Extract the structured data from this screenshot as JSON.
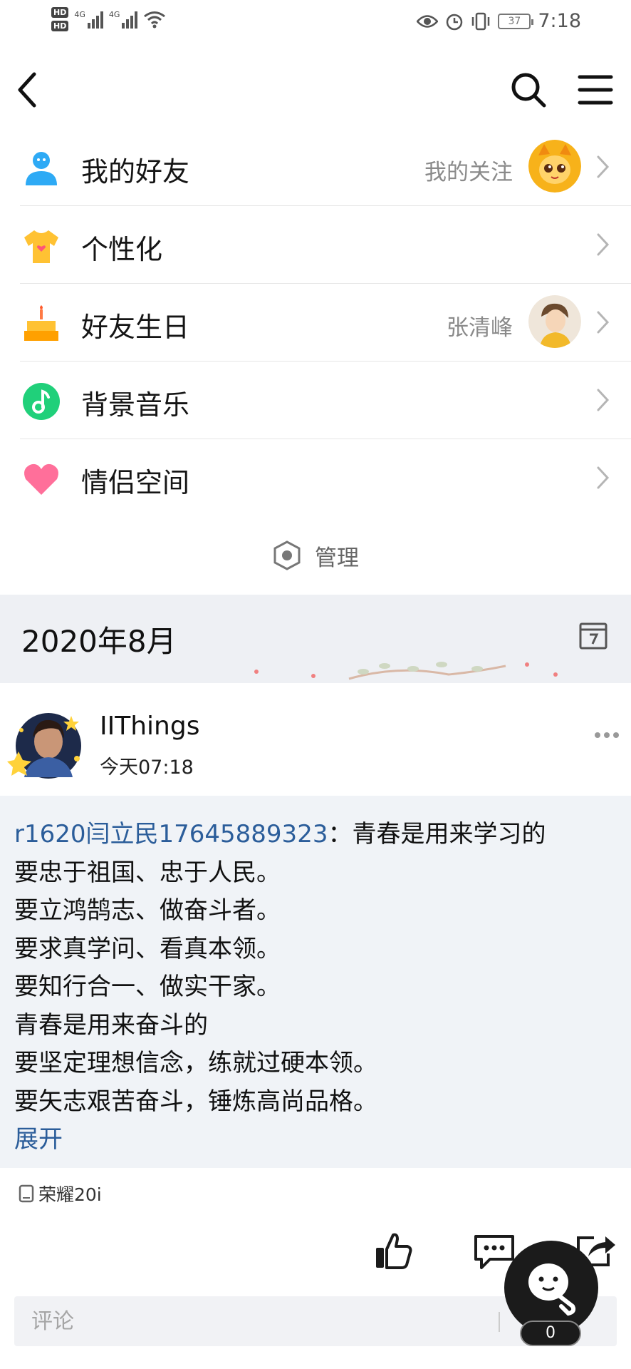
{
  "status_bar": {
    "time": "7:18",
    "battery": "37",
    "network_label_1": "4G",
    "network_label_2": "4G",
    "hd_1": "HD",
    "hd_2": "HD"
  },
  "menu": [
    {
      "label": "我的好友",
      "sub": "我的关注",
      "icon": "friends-icon",
      "color": "#2eaaf5"
    },
    {
      "label": "个性化",
      "sub": "",
      "icon": "tshirt-icon",
      "color": "#ffc233"
    },
    {
      "label": "好友生日",
      "sub": "张清峰",
      "icon": "cake-icon",
      "color": "#ffb020"
    },
    {
      "label": "背景音乐",
      "sub": "",
      "icon": "music-icon",
      "color": "#20d07a"
    },
    {
      "label": "情侣空间",
      "sub": "",
      "icon": "heart-icon",
      "color": "#ff6f9a"
    }
  ],
  "manage_label": "管理",
  "month_title": "2020年8月",
  "post": {
    "username": "IIThings",
    "time": "今天07:18",
    "mention": "r1620闫立民17645889323",
    "first_line_rest": "：青春是用来学习的",
    "lines": [
      "要忠于祖国、忠于人民。",
      "要立鸿鹄志、做奋斗者。",
      "要求真学问、看真本领。",
      "要知行合一、做实干家。",
      "青春是用来奋斗的",
      "要坚定理想信念，练就过硬本领。",
      "要矢志艰苦奋斗，锤炼高尚品格。"
    ],
    "expand_label": "展开",
    "device": "荣耀20i"
  },
  "comment": {
    "placeholder": "评论"
  },
  "float_count": "0",
  "colors": {
    "accent_link": "#2b5d9a",
    "month_bg": "#eef0f4",
    "post_bg": "#f0f3f7"
  }
}
